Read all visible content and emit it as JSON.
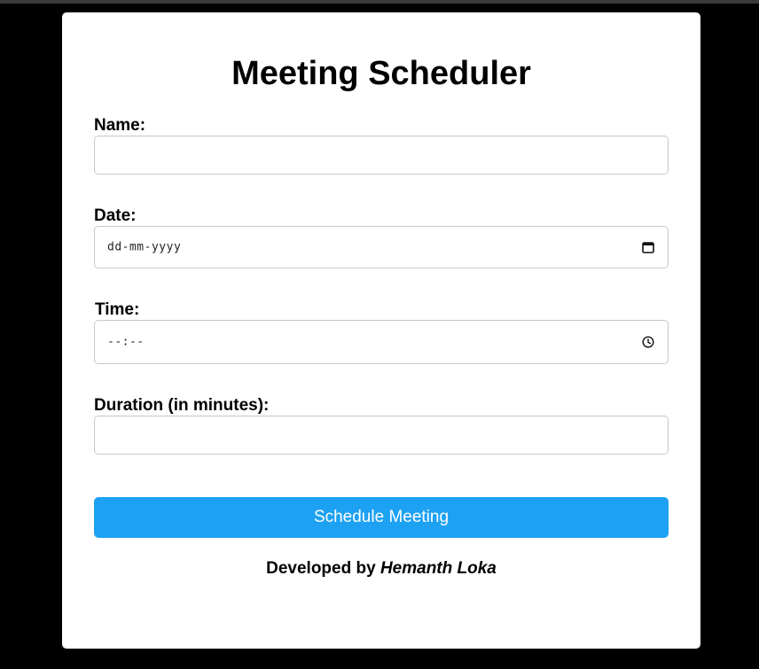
{
  "title": "Meeting Scheduler",
  "form": {
    "name_label": "Name:",
    "name_value": "",
    "date_label": "Date:",
    "date_placeholder": "dd-mm-yyyy",
    "time_label": "Time:",
    "time_placeholder": "--:--",
    "duration_label": "Duration (in minutes):",
    "duration_value": ""
  },
  "button": {
    "label": "Schedule Meeting"
  },
  "footer": {
    "prefix": "Developed by",
    "author": "Hemanth Loka"
  },
  "colors": {
    "background": "#000000",
    "card": "#ffffff",
    "button": "#1da1f2",
    "border": "#c8c8c8"
  },
  "icons": {
    "date": "calendar-icon",
    "time": "clock-icon"
  }
}
